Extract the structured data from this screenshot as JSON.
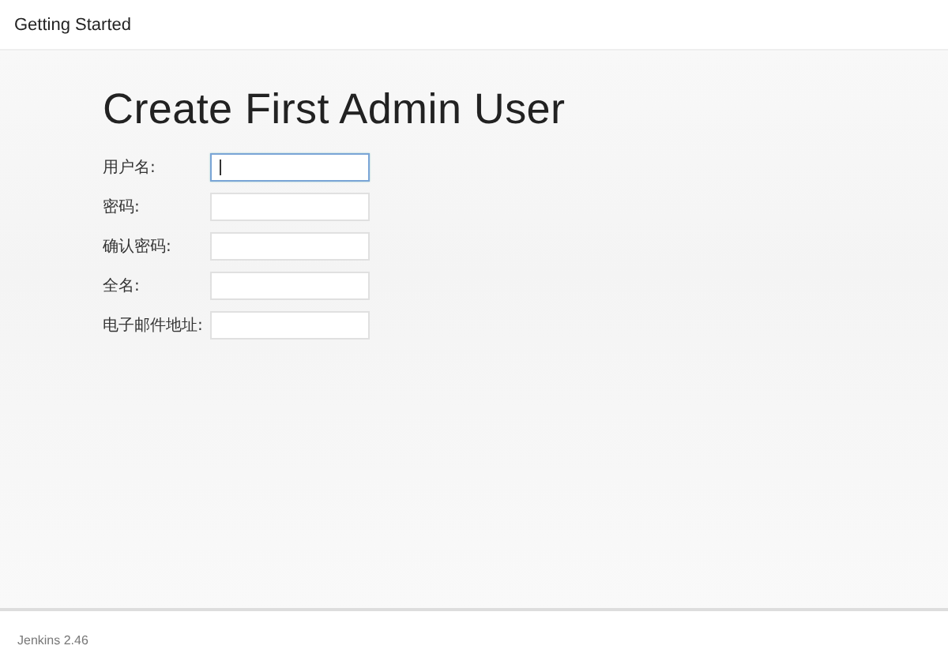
{
  "header": {
    "title": "Getting Started"
  },
  "page": {
    "heading": "Create First Admin User"
  },
  "form": {
    "fields": [
      {
        "label": "用户名:",
        "focused": true
      },
      {
        "label": "密码:",
        "focused": false
      },
      {
        "label": "确认密码:",
        "focused": false
      },
      {
        "label": "全名:",
        "focused": false
      },
      {
        "label": "电子邮件地址:",
        "focused": false
      }
    ]
  },
  "footer": {
    "version": "Jenkins 2.46"
  }
}
